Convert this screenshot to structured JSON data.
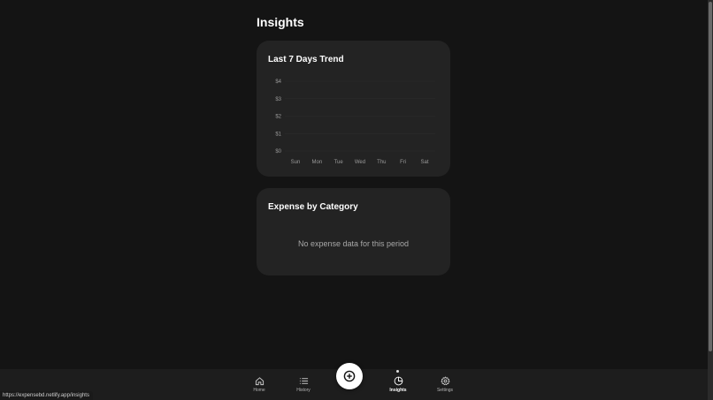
{
  "page": {
    "title": "Insights"
  },
  "trend": {
    "title": "Last 7 Days Trend",
    "y_ticks": [
      "$0",
      "$1",
      "$2",
      "$3",
      "$4"
    ],
    "x_ticks": [
      "Sun",
      "Mon",
      "Tue",
      "Wed",
      "Thu",
      "Fri",
      "Sat"
    ]
  },
  "category": {
    "title": "Expense by Category",
    "empty_message": "No expense data for this period"
  },
  "nav": {
    "home": "Home",
    "history": "History",
    "insights": "Insights",
    "settings": "Settings",
    "active": "insights"
  },
  "status_bar": {
    "url": "https://expensebd.netlify.app/insights"
  },
  "chart_data": {
    "type": "line",
    "title": "Last 7 Days Trend",
    "categories": [
      "Sun",
      "Mon",
      "Tue",
      "Wed",
      "Thu",
      "Fri",
      "Sat"
    ],
    "series": [],
    "ylim": [
      0,
      4
    ],
    "grid": true,
    "xlabel": "",
    "ylabel": ""
  },
  "colors": {
    "background": "#141414",
    "card": "#232323",
    "fab": "#ffffff"
  }
}
